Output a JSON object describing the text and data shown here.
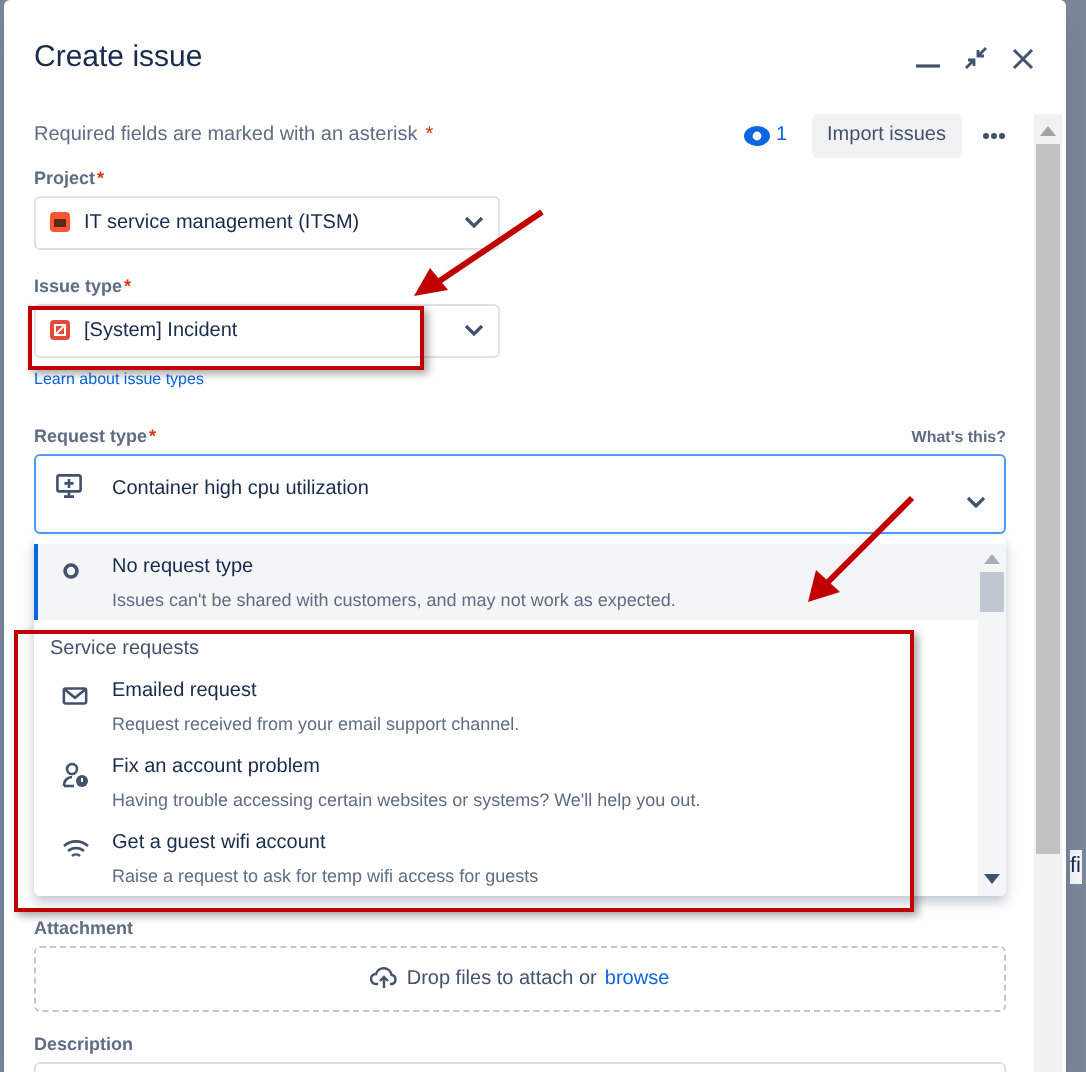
{
  "window": {
    "title": "Create issue"
  },
  "required_note": {
    "text": "Required fields are marked with an asterisk",
    "asterisk": "*"
  },
  "watchers": {
    "count": "1"
  },
  "import_button": "Import issues",
  "project": {
    "label": "Project",
    "asterisk": "*",
    "value": "IT service management (ITSM)"
  },
  "issue_type": {
    "label": "Issue type",
    "asterisk": "*",
    "value": "[System] Incident",
    "link": "Learn about issue types"
  },
  "request_type": {
    "label": "Request type",
    "asterisk": "*",
    "help": "What's this?",
    "value": "Container high cpu utilization",
    "expanded": true,
    "options": [
      {
        "kind": "option",
        "title": "No request type",
        "description": "Issues can't be shared with customers, and may not work as expected.",
        "selected": true
      },
      {
        "kind": "heading",
        "title": "Service requests"
      },
      {
        "kind": "option",
        "title": "Emailed request",
        "description": "Request received from your email support channel.",
        "selected": false
      },
      {
        "kind": "option",
        "title": "Fix an account problem",
        "description": "Having trouble accessing certain websites or systems? We'll help you out.",
        "selected": false
      },
      {
        "kind": "option",
        "title": "Get a guest wifi account",
        "description": "Raise a request to ask for temp wifi access for guests",
        "selected": false
      }
    ]
  },
  "attachment": {
    "label": "Attachment",
    "text": "Drop files to attach or",
    "link": "browse"
  },
  "description": {
    "label": "Description"
  },
  "background_text": "fi"
}
